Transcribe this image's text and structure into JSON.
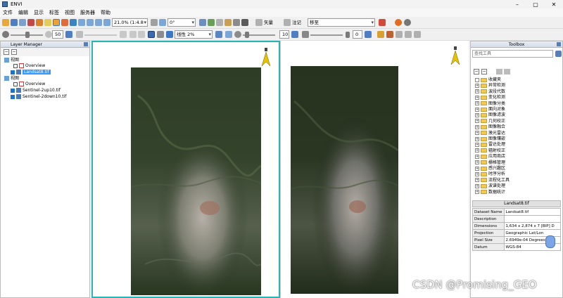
{
  "window": {
    "title": "ENVI",
    "min_icon": "minimize-icon",
    "max_icon": "maximize-icon",
    "close_icon": "close-icon"
  },
  "menu": [
    "文件",
    "编辑",
    "显示",
    "标签",
    "视图",
    "服务器",
    "帮助"
  ],
  "toolbar1": {
    "zoom_value": "21.0% (1:4.8",
    "rotation_value": "0°",
    "vector_label": "矢量",
    "annotation_label": "注记",
    "search_value": "移至"
  },
  "toolbar2": {
    "brightness_value": "50",
    "stretch_value": "线性 2%",
    "sharpen_value": "10",
    "transparency_value": "0"
  },
  "layer_manager": {
    "title": "Layer Manager",
    "view1_label": "视图",
    "view1_overview": "Overview",
    "view1_layer": "Landsat8.tif",
    "view2_label": "视图",
    "view2_overview": "Overview",
    "view2_layer1": "Sentinel-2up10.tif",
    "view2_layer2": "Sentinel-2down10.tif"
  },
  "toolbox": {
    "title": "Toolbox",
    "search_placeholder": "查找工具",
    "items": [
      "收藏夹",
      "异常检测",
      "波段代数",
      "变化检测",
      "图像分类",
      "面向对象",
      "图像滤波",
      "几何校正",
      "图像融合",
      "激光雷达",
      "图像镶嵌",
      "雷达处理",
      "辐射校正",
      "应用商店",
      "栅格管理",
      "感兴趣区",
      "时序分析",
      "流程化工具",
      "波谱处理",
      "数据统计"
    ]
  },
  "properties": {
    "title": "Landsat8.tif",
    "rows": [
      {
        "key": "Dataset Name",
        "value": "Landsat8.tif"
      },
      {
        "key": "Description",
        "value": ""
      },
      {
        "key": "Dimensions",
        "value": "1,634 x 2,874 x 7 [BIP] D"
      },
      {
        "key": "Projection",
        "value": "Geographic Lat/Lon"
      },
      {
        "key": "Pixel Size",
        "value": "2.6949e-04 Degrees"
      },
      {
        "key": "Datum",
        "value": "WGS-84"
      }
    ]
  },
  "watermark": "CSDN @Promising_GEO",
  "colors": {
    "selected": "#3399ff",
    "view_border": "#2ab5b5",
    "folder": "#f2c94c",
    "north_arrow": "#e6c200"
  }
}
